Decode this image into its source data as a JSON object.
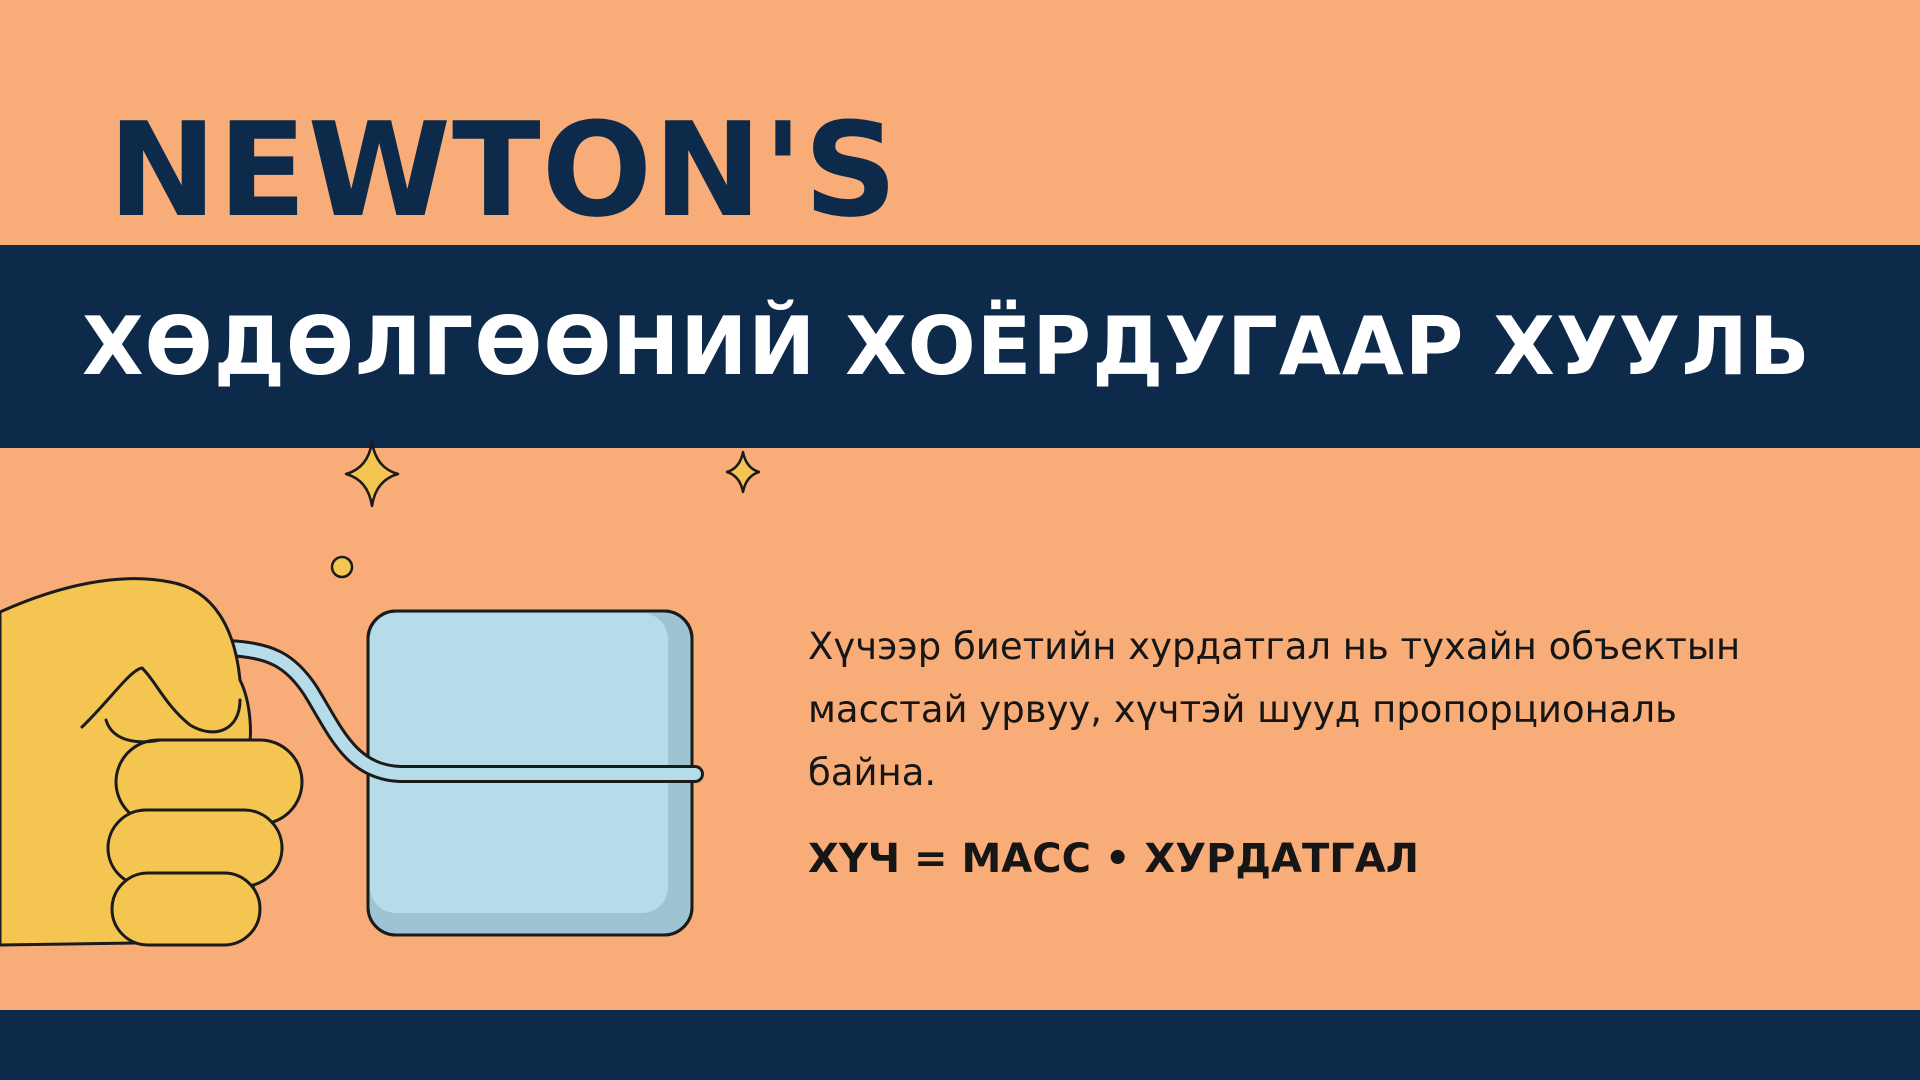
{
  "slide": {
    "top_title": "NEWTON'S",
    "banner_title": "ХӨДӨЛГӨӨНИЙ ХОЁРДУГААР ХУУЛЬ",
    "description": "Хүчээр биетийн хурдатгал нь тухайн объектын масстай урвуу, хүчтэй шууд пропорциональ байна.",
    "formula": "ХҮЧ = МАСС • ХУРДАТГАЛ"
  },
  "colors": {
    "background": "#f8ad78",
    "navy": "#0e2a4a",
    "text": "#161616",
    "hand": "#f5c552",
    "block": "#b6dcea",
    "block_shade": "#9ec4d4",
    "sparkle": "#f5c552"
  },
  "illustration": {
    "icons": [
      "hand-icon",
      "block-icon",
      "rope-icon",
      "sparkle-icon",
      "dot-icon"
    ]
  }
}
